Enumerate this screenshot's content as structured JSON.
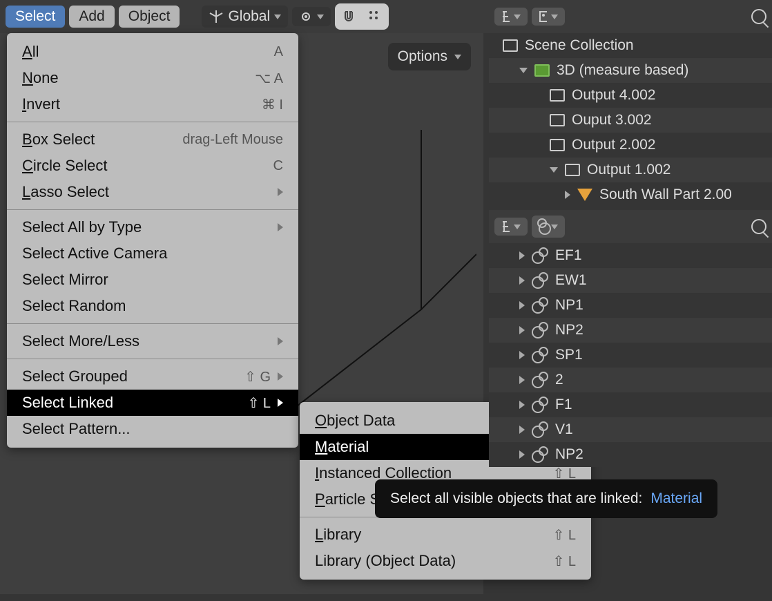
{
  "header": {
    "select": "Select",
    "add": "Add",
    "object": "Object",
    "orientation": "Global",
    "options": "Options"
  },
  "select_menu": {
    "all": "All",
    "all_sc": "A",
    "none": "None",
    "none_sc": "⌥ A",
    "invert": "Invert",
    "invert_sc": "⌘ I",
    "box": "Box Select",
    "box_sc": "drag-Left Mouse",
    "circle": "Circle Select",
    "circle_sc": "C",
    "lasso": "Lasso Select",
    "by_type": "Select All by Type",
    "active_cam": "Select Active Camera",
    "mirror": "Select Mirror",
    "random": "Select Random",
    "more_less": "Select More/Less",
    "grouped": "Select Grouped",
    "grouped_sc": "⇧ G",
    "linked": "Select Linked",
    "linked_sc": "⇧ L",
    "pattern": "Select Pattern..."
  },
  "linked_menu": {
    "obj_data": "Object Data",
    "sc": "⇧ L",
    "material": "Material",
    "instanced": "Instanced Collection",
    "particle": "Particle System",
    "library": "Library",
    "library_od": "Library (Object Data)"
  },
  "outliner": {
    "root": "Scene Collection",
    "coll": "3D (measure based)",
    "o4": "Output 4.002",
    "o3": "Ouput 3.002",
    "o2": "Output 2.002",
    "o1": "Output 1.002",
    "sw": "South Wall Part 2.00"
  },
  "materials": [
    "EF1",
    "EW1",
    "NP1",
    "NP2",
    "SP1",
    "2",
    "F1",
    "V1",
    "NP2"
  ],
  "tooltip": {
    "text": "Select all visible objects that are linked:",
    "link": "Material"
  },
  "colors": {
    "hl_blue": "#4f7bb7",
    "accent_orange": "#e6a23c"
  }
}
